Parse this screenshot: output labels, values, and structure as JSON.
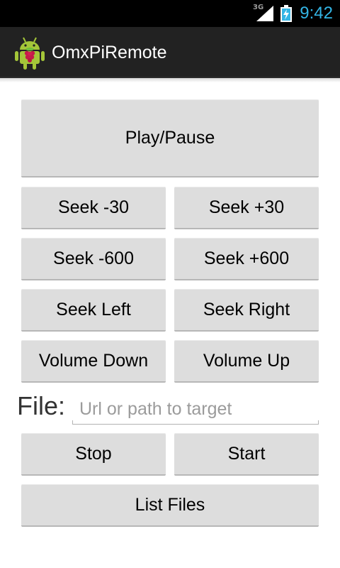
{
  "status_bar": {
    "network": "3G",
    "time": "9:42"
  },
  "action_bar": {
    "title": "OmxPiRemote"
  },
  "controls": {
    "play_pause": "Play/Pause",
    "seek_minus_30": "Seek -30",
    "seek_plus_30": "Seek +30",
    "seek_minus_600": "Seek -600",
    "seek_plus_600": "Seek +600",
    "seek_left": "Seek Left",
    "seek_right": "Seek Right",
    "volume_down": "Volume Down",
    "volume_up": "Volume Up"
  },
  "file": {
    "label": "File:",
    "value": "",
    "placeholder": "Url or path to target"
  },
  "actions": {
    "stop": "Stop",
    "start": "Start",
    "list_files": "List Files"
  },
  "colors": {
    "accent": "#33b5e5",
    "button": "#dddddd",
    "action_bar": "#222222"
  }
}
